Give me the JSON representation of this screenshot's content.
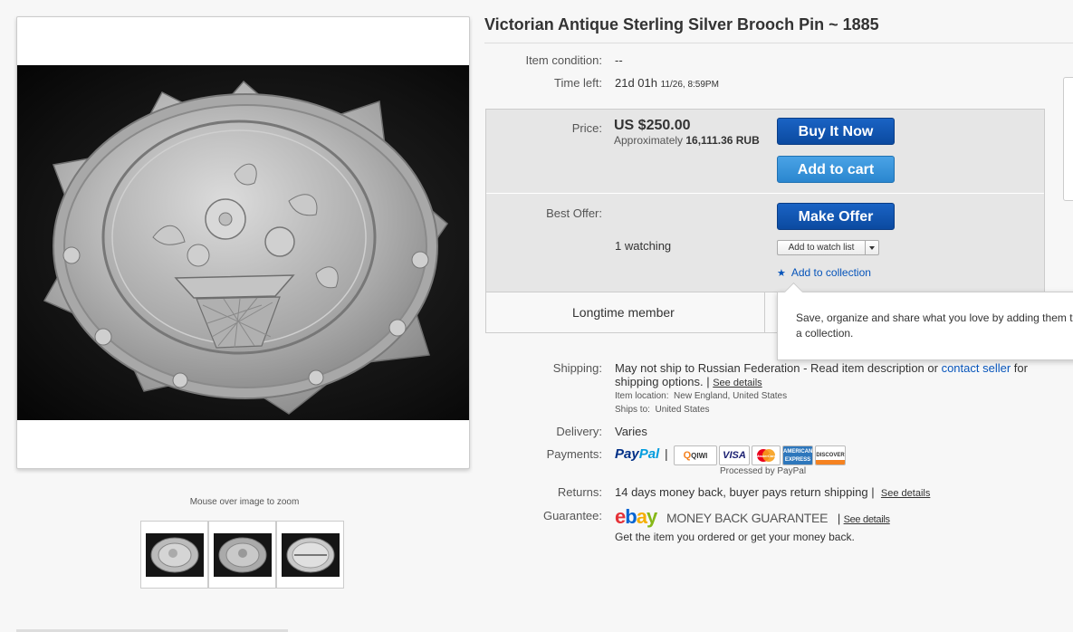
{
  "item": {
    "title": "Victorian Antique Sterling Silver Brooch Pin ~ 1885"
  },
  "image_viewer": {
    "zoom_hint": "Mouse over image to zoom",
    "thumbnails": [
      "front view",
      "front view alt",
      "back view"
    ]
  },
  "details": {
    "condition_label": "Item condition:",
    "condition_value": "--",
    "time_left_label": "Time left:",
    "time_left_value": "21d 01h",
    "time_left_end": "11/26, 8:59PM"
  },
  "purchase": {
    "price_label": "Price:",
    "price_value": "US $250.00",
    "approx_prefix": "Approximately",
    "approx_value": "16,111.36 RUB",
    "buy_now_label": "Buy It Now",
    "add_to_cart_label": "Add to cart",
    "best_offer_label": "Best Offer:",
    "make_offer_label": "Make Offer",
    "watching_text": "1 watching",
    "watch_list_label": "Add to watch list",
    "collection_label": "Add to collection",
    "member_text": "Longtime member",
    "tooltip_text": "Save, organize and share what you love by adding them to a collection."
  },
  "shipping": {
    "label": "Shipping:",
    "text_before_link": "May not ship to Russian Federation - Read item description or",
    "contact_link": "contact seller",
    "text_after_link": "for",
    "line2": "shipping options.",
    "separator": "|",
    "see_details": "See details",
    "location_label": "Item location:",
    "location_value": "New England, United States",
    "ships_to_label": "Ships to:",
    "ships_to_value": "United States"
  },
  "delivery": {
    "label": "Delivery:",
    "value": "Varies"
  },
  "payments": {
    "label": "Payments:",
    "paypal_a": "Pay",
    "paypal_b": "Pal",
    "separator": "|",
    "cards": [
      "QIWI",
      "VISA",
      "MasterCard",
      "AMERICAN EXPRESS",
      "DISCOVER"
    ],
    "processed_by": "Processed by PayPal"
  },
  "returns": {
    "label": "Returns:",
    "value": "14 days money back, buyer pays return shipping",
    "separator": "|",
    "see_details": "See details"
  },
  "guarantee": {
    "label": "Guarantee:",
    "logo": [
      "e",
      "b",
      "a",
      "y"
    ],
    "title": "MONEY BACK GUARANTEE",
    "separator": "|",
    "see_details": "See details",
    "subtext": "Get the item you ordered or get your money back."
  },
  "colors": {
    "link": "#0654ba",
    "button_dark": "#0b4aa0",
    "button_light": "#2a86cf",
    "buy_box_bg": "#e6e6e6"
  }
}
